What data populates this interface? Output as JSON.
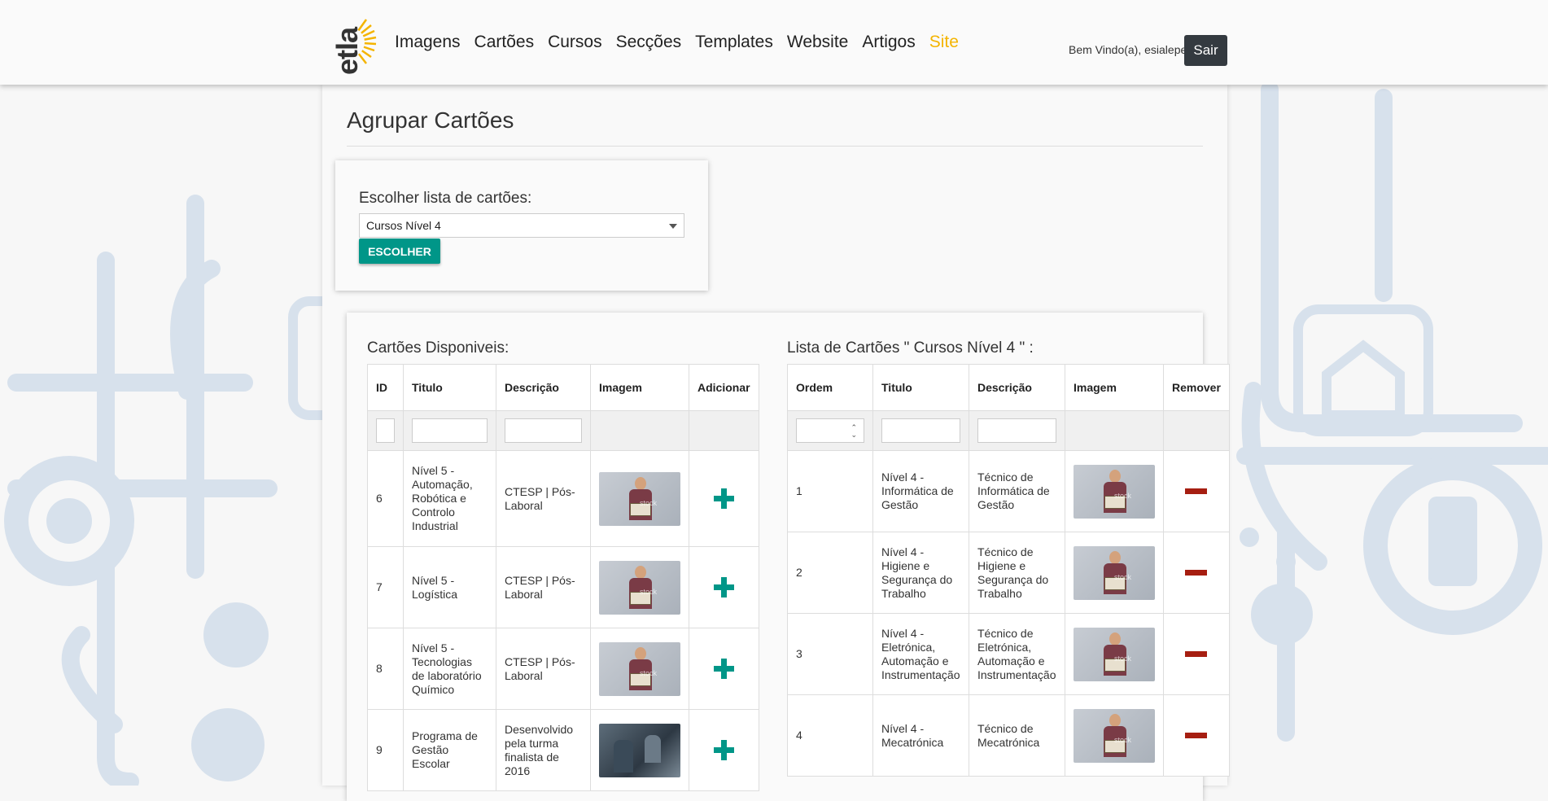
{
  "nav": {
    "logo_text": "etla",
    "links": [
      "Imagens",
      "Cartões",
      "Cursos",
      "Secções",
      "Templates",
      "Website",
      "Artigos",
      "Site"
    ],
    "welcome": "Bem Vindo(a), esialepe",
    "logout_label": "Sair"
  },
  "page": {
    "title": "Agrupar Cartões"
  },
  "chooser": {
    "label": "Escolher lista de cartões:",
    "selected": "Cursos Nível 4",
    "button_label": "ESCOLHER"
  },
  "available": {
    "title": "Cartões Disponiveis:",
    "headers": [
      "ID",
      "Titulo",
      "Descrição",
      "Imagem",
      "Adicionar"
    ],
    "rows": [
      {
        "id": "6",
        "title": "Nível 5 - Automação, Robótica e Controlo Industrial",
        "description": "CTESP | Pós-Laboral",
        "image": "student"
      },
      {
        "id": "7",
        "title": "Nível 5 - Logística",
        "description": "CTESP | Pós-Laboral",
        "image": "student"
      },
      {
        "id": "8",
        "title": "Nível 5 - Tecnologias de laboratório Químico",
        "description": "CTESP | Pós-Laboral",
        "image": "student"
      },
      {
        "id": "9",
        "title": "Programa de Gestão Escolar",
        "description": "Desenvolvido pela turma finalista de 2016",
        "image": "lab"
      }
    ]
  },
  "selected_list": {
    "title": "Lista de Cartões \" Cursos Nível 4 \" :",
    "headers": [
      "Ordem",
      "Titulo",
      "Descrição",
      "Imagem",
      "Remover"
    ],
    "rows": [
      {
        "order": "1",
        "title": "Nível 4 - Informática de Gestão",
        "description": "Técnico de Informática de Gestão",
        "image": "student"
      },
      {
        "order": "2",
        "title": "Nível 4 - Higiene e Segurança do Trabalho",
        "description": "Técnico de Higiene e Segurança do Trabalho",
        "image": "student"
      },
      {
        "order": "3",
        "title": "Nível 4 - Eletrónica, Automação e Instrumentação",
        "description": "Técnico de Eletrónica, Automação e Instrumentação",
        "image": "student"
      },
      {
        "order": "4",
        "title": "Nível 4 - Mecatrónica",
        "description": "Técnico de Mecatrónica",
        "image": "student"
      }
    ]
  },
  "colors": {
    "accent": "#009688",
    "nav_active": "#f4b400",
    "remove": "#a61e11",
    "dark_button": "#343a40",
    "background_icons": "#d7e1ec"
  }
}
